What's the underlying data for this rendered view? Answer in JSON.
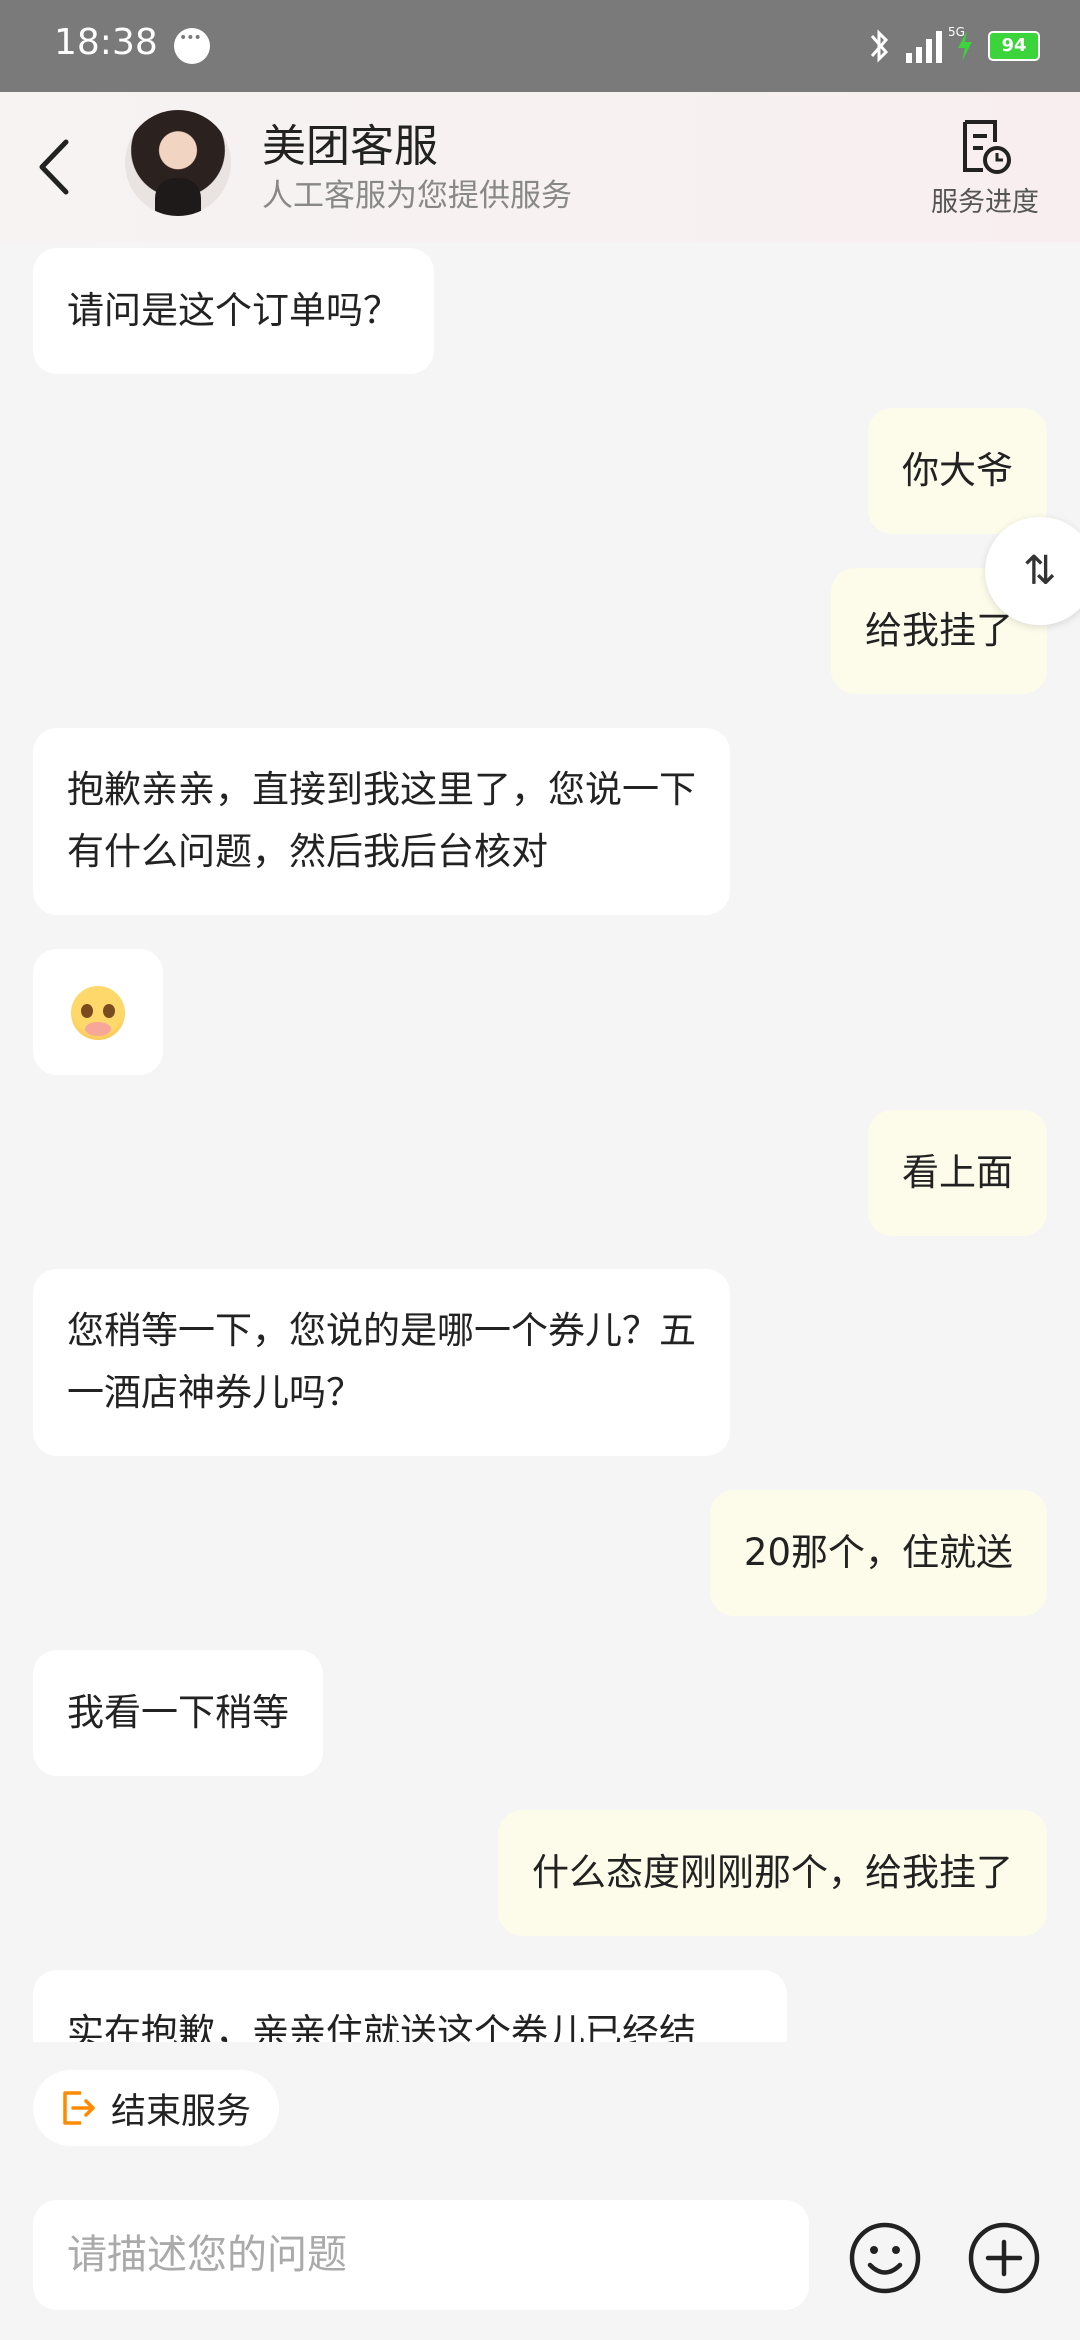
{
  "status_bar": {
    "time": "18:38",
    "network": "5G",
    "battery": "94"
  },
  "header": {
    "title": "美团客服",
    "subtitle": "人工客服为您提供服务",
    "progress_label": "服务进度"
  },
  "messages": [
    {
      "side": "left",
      "text": "请问是这个订单吗？"
    },
    {
      "side": "right",
      "text": "你大爷"
    },
    {
      "side": "right",
      "text": "给我挂了"
    },
    {
      "side": "left",
      "lines": [
        "抱歉亲亲，直接到我这里了，您说一下",
        "有什么问题，然后我后台核对"
      ]
    },
    {
      "side": "left",
      "emoji": "pleading-face"
    },
    {
      "side": "right",
      "text": "看上面"
    },
    {
      "side": "left",
      "lines": [
        "您稍等一下，您说的是哪一个券儿？五",
        "一酒店神券儿吗？"
      ]
    },
    {
      "side": "right",
      "text": "20那个，住就送"
    },
    {
      "side": "left",
      "text": "我看一下稍等"
    },
    {
      "side": "right",
      "text": "什么态度刚刚那个，给我挂了"
    },
    {
      "side": "left",
      "text": "实在抱歉，亲亲住就送这个券儿已经结"
    }
  ],
  "float_button": "⇅",
  "end_service_label": "结束服务",
  "input": {
    "placeholder": "请描述您的问题"
  },
  "colors": {
    "status_bar": "#7a7a7a",
    "bubble_right": "#fdfbea",
    "bubble_left": "#ffffff",
    "accent": "#ff8a00",
    "battery": "#3bd43b"
  }
}
